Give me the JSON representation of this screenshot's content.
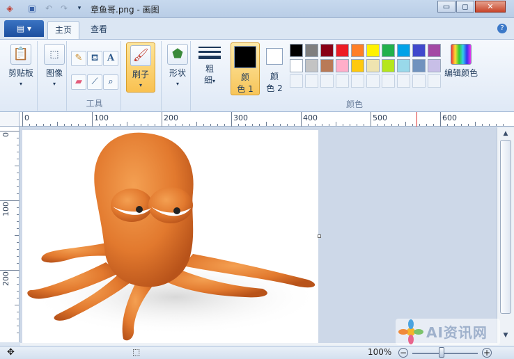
{
  "window": {
    "title": "章鱼哥.png - 画图",
    "controls": {
      "minimize": "▭",
      "maximize": "◻",
      "close": "✕"
    }
  },
  "quick_access": {
    "app_icon": "paint-app-icon",
    "items": [
      "save-icon",
      "undo-icon",
      "redo-icon",
      "customize-dropdown-icon"
    ]
  },
  "tabs": {
    "file_label": "▤ ▾",
    "items": [
      {
        "label": "主页",
        "active": true
      },
      {
        "label": "查看",
        "active": false
      }
    ],
    "help": "?"
  },
  "ribbon": {
    "clipboard": {
      "label": "剪贴板"
    },
    "image": {
      "label": "图像"
    },
    "tools": {
      "label": "工具",
      "icons": [
        "pencil-icon",
        "fill-icon",
        "text-icon",
        "eraser-icon",
        "color-picker-icon",
        "magnifier-icon"
      ],
      "text_glyph": "A"
    },
    "brushes": {
      "label": "刷子"
    },
    "shapes": {
      "label": "形状"
    },
    "size": {
      "label_line1": "粗",
      "label_line2": "细"
    },
    "color1": {
      "label_line1": "颜",
      "label_line2": "色 1",
      "value": "#000000"
    },
    "color2": {
      "label_line1": "颜",
      "label_line2": "色 2",
      "value": "#ffffff"
    },
    "colors_group": {
      "label": "颜色"
    },
    "edit_colors": {
      "label": "编辑颜色"
    },
    "palette_row1": [
      "#000000",
      "#7f7f7f",
      "#880015",
      "#ed1c24",
      "#ff7f27",
      "#fff200",
      "#22b14c",
      "#00a2e8",
      "#3f48cc",
      "#a349a4"
    ],
    "palette_row2": [
      "#ffffff",
      "#c3c3c3",
      "#b97a57",
      "#ffaec9",
      "#ffc90e",
      "#efe4b0",
      "#b5e61d",
      "#99d9ea",
      "#7092be",
      "#c8bfe7"
    ],
    "palette_row3_count": 10
  },
  "ruler": {
    "x_ticks": [
      "0",
      "100",
      "200",
      "300",
      "400",
      "500",
      "600"
    ],
    "y_ticks": [
      "0",
      "100",
      "200"
    ]
  },
  "canvas": {
    "image_subject": "orange-octopus-image",
    "bg": "#ffffff",
    "work_bg": "#cdd8e8"
  },
  "status": {
    "zoom": "100%",
    "zoom_out": "−",
    "zoom_in": "+"
  },
  "watermark": {
    "text": "AI资讯网"
  },
  "colors": {
    "accent": "#1c4f9f",
    "octopus": "#e2792e"
  }
}
